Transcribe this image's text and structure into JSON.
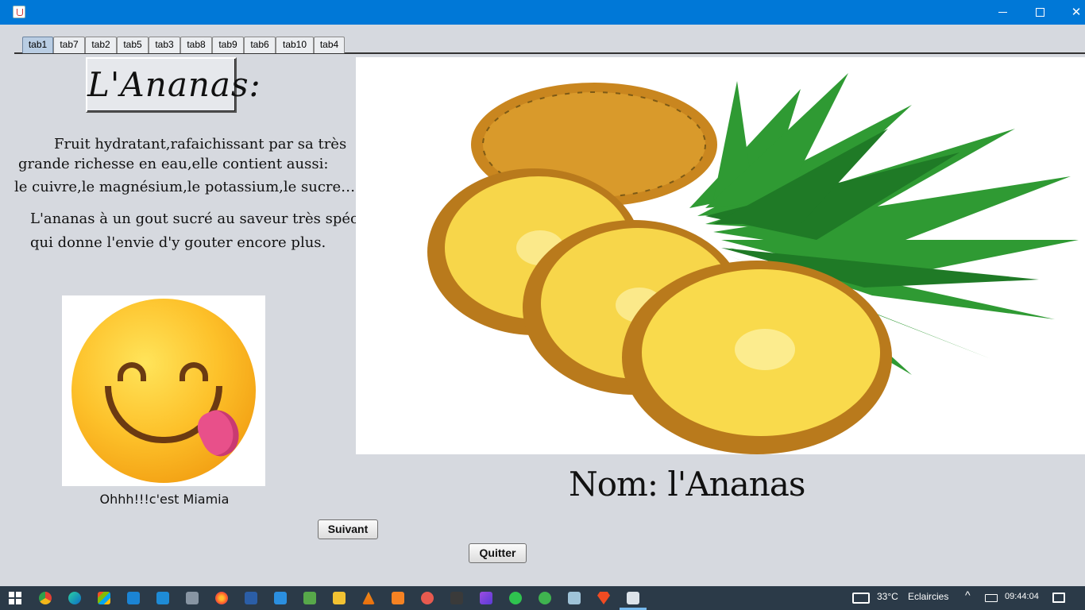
{
  "window": {
    "title": ""
  },
  "tabs": [
    "tab1",
    "tab7",
    "tab2",
    "tab5",
    "tab3",
    "tab8",
    "tab9",
    "tab6",
    "tab10",
    "tab4"
  ],
  "active_tab": "tab1",
  "content": {
    "heading": "L'Ananas:",
    "description_lines": [
      "Fruit hydratant,rafaichissant par sa très",
      "grande richesse en eau,elle contient aussi:",
      "le cuivre,le magnésium,le potassium,le sucre…",
      "L'ananas à un gout sucré au saveur très spéciale",
      "qui donne l'envie d'y gouter encore plus."
    ],
    "emoji_caption": "Ohhh!!!c'est Miamia",
    "name_label": "Nom: l'Ananas",
    "buttons": {
      "next": "Suivant",
      "quit": "Quitter"
    }
  },
  "taskbar": {
    "weather_temp": "33°C",
    "weather_desc": "Eclaircies",
    "time": "09:44:04",
    "app_icons": [
      "windows-start-icon",
      "chrome-icon",
      "edge-icon",
      "store-icon",
      "vscode-icon",
      "mail-icon",
      "camera-icon",
      "firefox-icon",
      "word-icon",
      "app-icon",
      "app-icon",
      "folder-icon",
      "vlc-icon",
      "xampp-icon",
      "app-icon",
      "app-icon",
      "app-icon",
      "whatsapp-icon",
      "app-icon",
      "app-icon",
      "brave-icon",
      "java-icon"
    ]
  },
  "colors": {
    "titlebar": "#0078d7",
    "background": "#d6d9df",
    "taskbar": "#2b3a48",
    "active_tab": "#b9cde3"
  }
}
